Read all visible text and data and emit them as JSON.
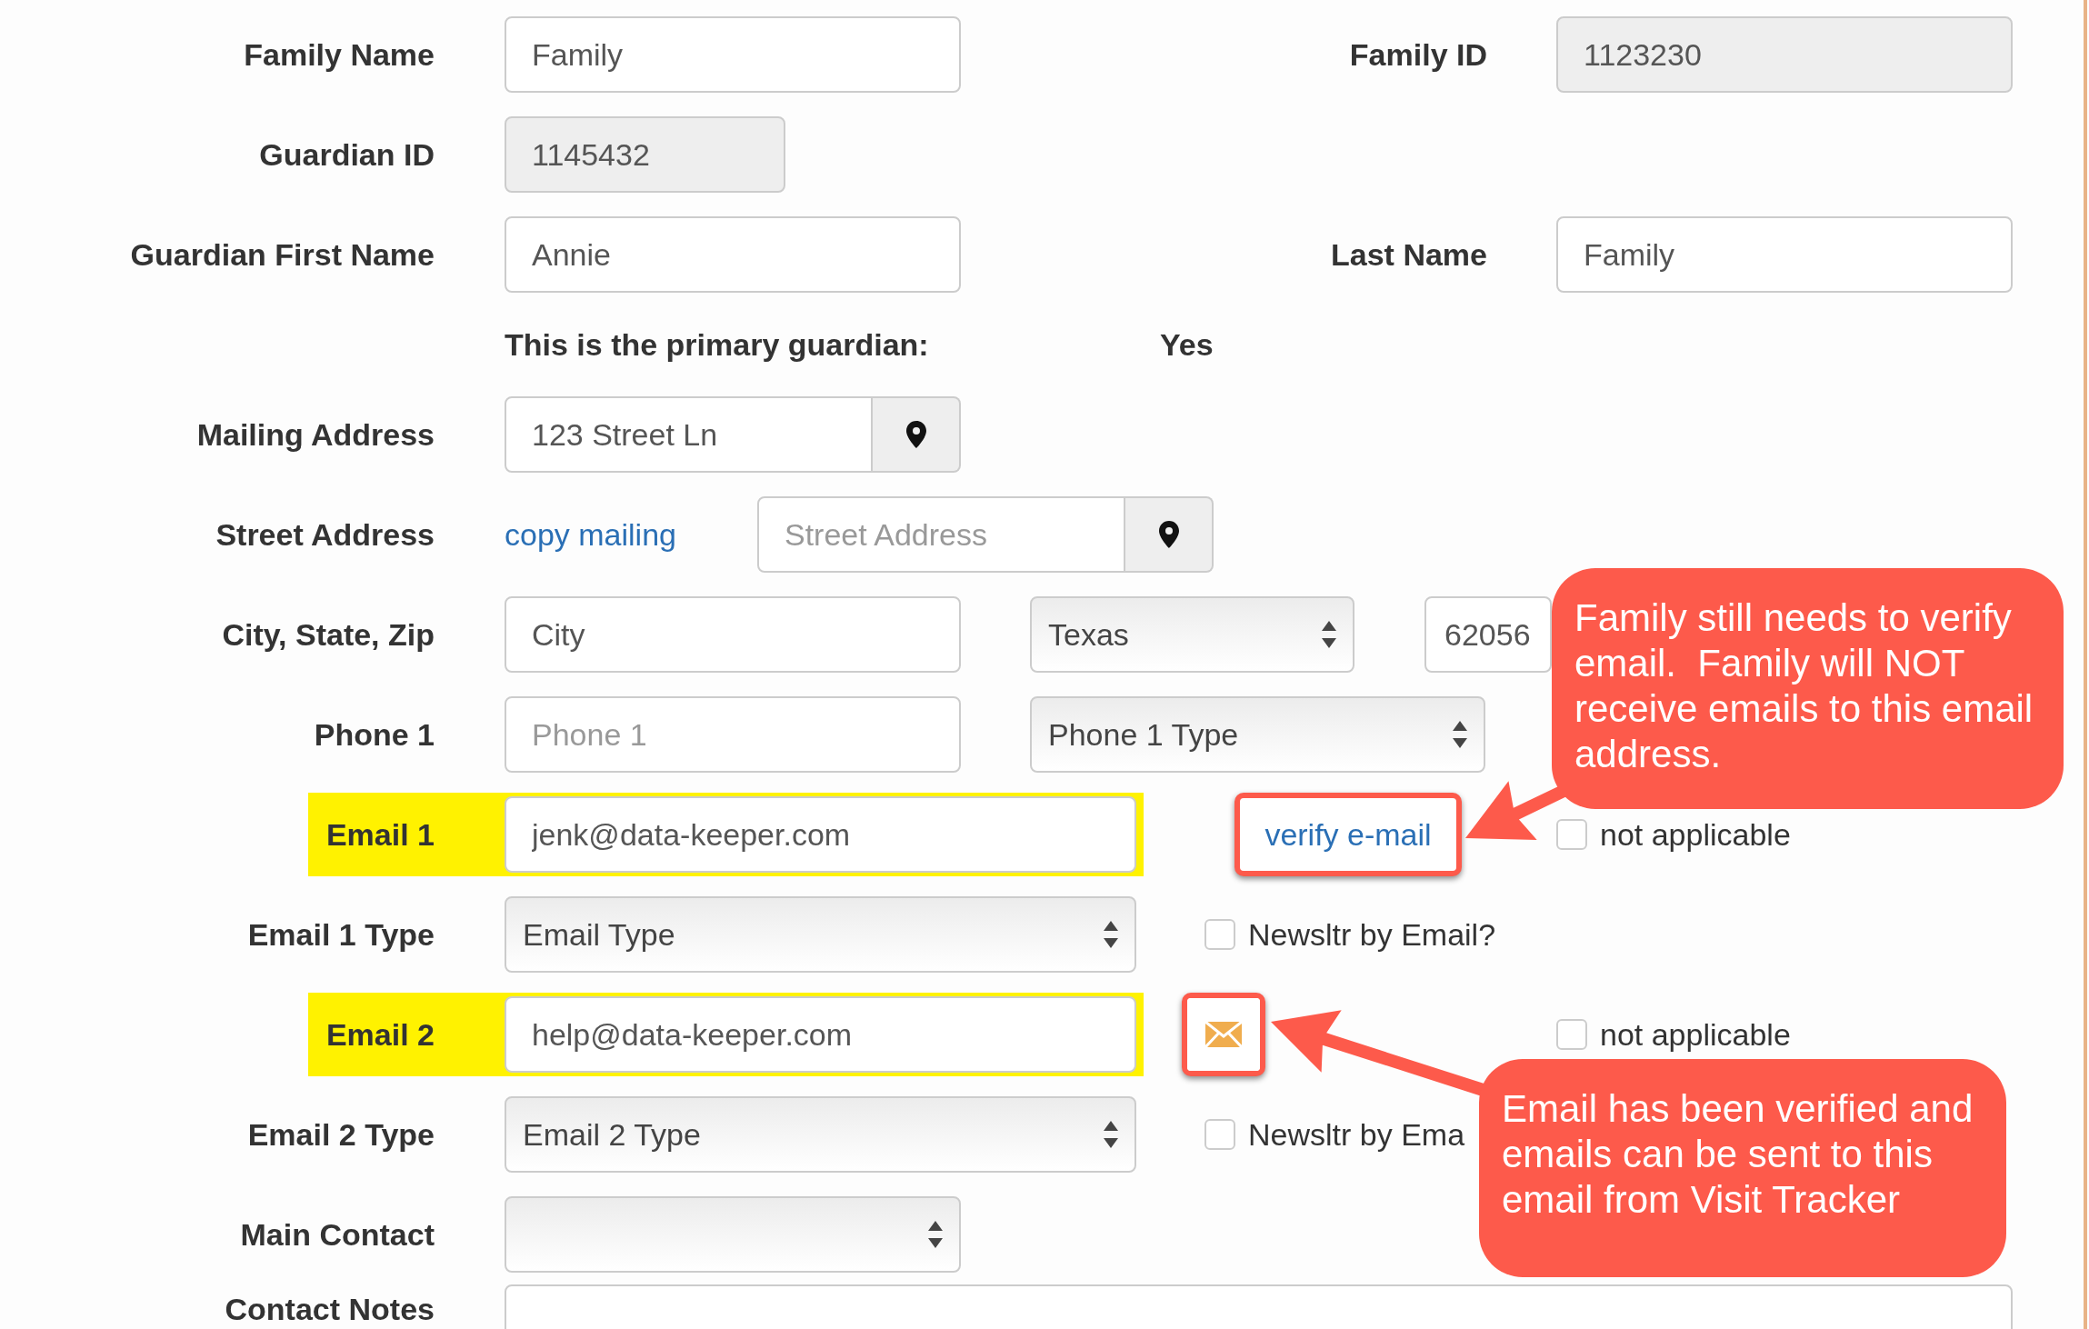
{
  "form": {
    "rows": [
      {
        "label": "Family Name",
        "highlighted": false,
        "items": [
          {
            "kind": "input",
            "value": "Family",
            "readonly": false
          },
          {
            "kind": "label",
            "text": "Family ID"
          },
          {
            "kind": "input",
            "value": "1123230",
            "readonly": true
          }
        ]
      },
      {
        "label": "Guardian ID",
        "highlighted": false,
        "items": [
          {
            "kind": "input",
            "value": "1145432",
            "readonly": true
          }
        ]
      },
      {
        "label": "Guardian First Name",
        "highlighted": false,
        "items": [
          {
            "kind": "input",
            "value": "Annie",
            "readonly": false
          },
          {
            "kind": "label",
            "text": "Last Name"
          },
          {
            "kind": "input",
            "value": "Family",
            "readonly": false
          }
        ]
      },
      {
        "highlighted": false,
        "items": [
          {
            "kind": "text",
            "text": "This is the primary guardian:"
          },
          {
            "kind": "text",
            "text": "Yes"
          }
        ]
      },
      {
        "label": "Mailing Address",
        "highlighted": false,
        "items": [
          {
            "kind": "address",
            "value": "123 Street Ln"
          }
        ]
      },
      {
        "label": "Street Address",
        "highlighted": false,
        "items": [
          {
            "kind": "link",
            "text": "copy mailing",
            "framed": false
          },
          {
            "kind": "address",
            "placeholder": "Street Address"
          }
        ]
      },
      {
        "label": "City, State, Zip",
        "highlighted": false,
        "items": [
          {
            "kind": "input",
            "value": "City",
            "readonly": false
          },
          {
            "kind": "select",
            "value": "Texas"
          },
          {
            "kind": "input",
            "value": "62056",
            "readonly": false
          }
        ]
      },
      {
        "label": "Phone 1",
        "highlighted": false,
        "items": [
          {
            "kind": "input",
            "placeholder": "Phone 1",
            "readonly": false
          },
          {
            "kind": "select",
            "value": "Phone 1 Type"
          }
        ]
      },
      {
        "label": "Email 1",
        "highlighted": true,
        "items": [
          {
            "kind": "input",
            "value": "jenk@data-keeper.com",
            "readonly": false
          },
          {
            "kind": "link",
            "text": "verify e-mail",
            "framed": true
          },
          {
            "kind": "checkbox",
            "text": "not applicable",
            "checked": false
          }
        ]
      },
      {
        "label": "Email 1 Type",
        "highlighted": false,
        "items": [
          {
            "kind": "select",
            "value": "Email Type"
          },
          {
            "kind": "checkbox",
            "text": "Newsltr by Email?",
            "checked": false
          }
        ]
      },
      {
        "label": "Email 2",
        "highlighted": true,
        "items": [
          {
            "kind": "input",
            "value": "help@data-keeper.com",
            "readonly": false
          },
          {
            "kind": "mail_button",
            "framed": true
          },
          {
            "kind": "checkbox",
            "text": "not applicable",
            "checked": false
          }
        ]
      },
      {
        "label": "Email 2 Type",
        "highlighted": false,
        "items": [
          {
            "kind": "select",
            "value": "Email 2 Type"
          },
          {
            "kind": "checkbox",
            "text": "Newsltr by Ema",
            "checked": false
          }
        ]
      },
      {
        "label": "Main Contact",
        "highlighted": false,
        "items": [
          {
            "kind": "select"
          }
        ]
      },
      {
        "label": "Contact Notes",
        "highlighted": false,
        "items": [
          {
            "kind": "textarea"
          }
        ]
      }
    ]
  },
  "callouts": [
    {
      "text": "Family still needs to verify email.  Family will NOT receive emails to this email address."
    },
    {
      "text": "Email has been verified and emails can be sent to this email from Visit Tracker"
    }
  ]
}
